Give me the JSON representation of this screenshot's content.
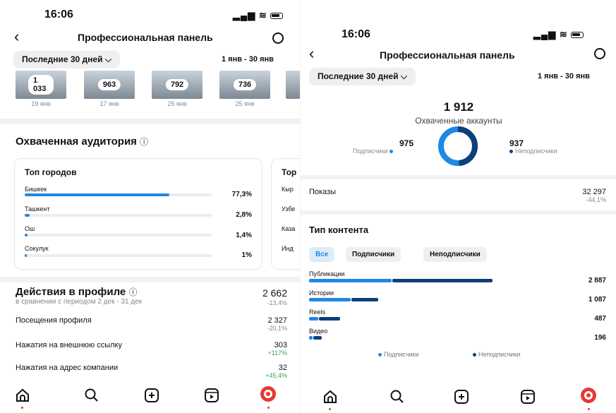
{
  "colors": {
    "accent": "#1e88e5",
    "dark_accent": "#0d3f7a",
    "positive": "#3aa35a"
  },
  "left": {
    "status": {
      "time": "16:06"
    },
    "header": {
      "title": "Профессиональная панель"
    },
    "filter": {
      "period": "Последние 30 дней",
      "range": "1 янв - 30 янв"
    },
    "thumbnails": [
      {
        "count": "1 033",
        "date": "19 янв"
      },
      {
        "count": "963",
        "date": "17 янв"
      },
      {
        "count": "792",
        "date": "25 янв"
      },
      {
        "count": "736",
        "date": "25 янв"
      }
    ],
    "audience": {
      "title": "Охваченная аудитория",
      "cities_title": "Топ городов",
      "next_card_title": "Тор",
      "cities": [
        {
          "name": "Бишкек",
          "percent": "77,3%",
          "value": 0.773
        },
        {
          "name": "Ташкент",
          "percent": "2,8%",
          "value": 0.028
        },
        {
          "name": "Ош",
          "percent": "1,4%",
          "value": 0.014
        },
        {
          "name": "Сокулук",
          "percent": "1%",
          "value": 0.01
        }
      ],
      "next_labels": [
        "Кыр",
        "Узбе",
        "Каза",
        "Инд"
      ]
    },
    "actions": {
      "title": "Действия в профиле",
      "subtitle": "в сравнении с периодом 2 дек - 31 дек",
      "total": "2 662",
      "total_change": "-13,4%",
      "rows": [
        {
          "label": "Посещения профиля",
          "value": "2 327",
          "change": "-20,1%"
        },
        {
          "label": "Нажатия на внешнюю ссылку",
          "value": "303",
          "change": "+117%"
        },
        {
          "label": "Нажатия на адрес компании",
          "value": "32",
          "change": "+45,4%"
        }
      ]
    }
  },
  "right": {
    "status": {
      "time": "16:06"
    },
    "header": {
      "title": "Профессиональная панель"
    },
    "filter": {
      "period": "Последние 30 дней",
      "range": "1 янв - 30 янв"
    },
    "reach": {
      "total": "1 912",
      "label": "Охваченные аккаунты",
      "followers": {
        "value": "975",
        "label": "Подписчики"
      },
      "non_followers": {
        "value": "937",
        "label": "Неподписчики"
      }
    },
    "impressions": {
      "label": "Показы",
      "value": "32 297",
      "change": "-44,1%"
    },
    "content_type": {
      "title": "Тип контента",
      "chips": [
        "Все",
        "Подписчики",
        "Неподписчики"
      ],
      "rows": [
        {
          "label": "Публикации",
          "value": "2 887",
          "followers": 0.45,
          "non_followers": 0.55
        },
        {
          "label": "Истории",
          "value": "1 087",
          "followers": 0.6,
          "non_followers": 0.4
        },
        {
          "label": "Reels",
          "value": "487",
          "followers": 0.3,
          "non_followers": 0.7
        },
        {
          "label": "Видео",
          "value": "196",
          "followers": 0.3,
          "non_followers": 0.7
        }
      ],
      "legend": [
        "Подписчики",
        "Неподписчики"
      ]
    }
  }
}
